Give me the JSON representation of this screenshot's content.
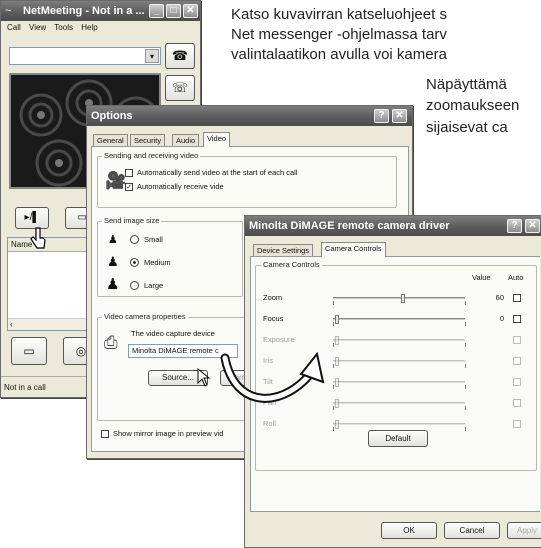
{
  "manual": {
    "line1": "Katso kuvavirran katseluohjeet s",
    "line2": "Net messenger -ohjelmassa tarv",
    "line3": "valintalaatikon avulla voi kamera",
    "line4": "Näpäyttämä",
    "line5": "zoomaukseen",
    "line6": "sijaisevat ca"
  },
  "netmeeting": {
    "title": "NetMeeting - Not in a ...",
    "menu": [
      "Call",
      "View",
      "Tools",
      "Help"
    ],
    "list_header": "Name",
    "status": "Not in a call"
  },
  "options": {
    "title": "Options",
    "tabs": [
      "General",
      "Security",
      "Audio",
      "Video"
    ],
    "group_sending": "Sending and receiving video",
    "auto_send": "Automatically send video at the start of each call",
    "auto_receive": "Automatically receive vide",
    "group_size": "Send image size",
    "size_small": "Small",
    "size_medium": "Medium",
    "size_large": "Large",
    "group_camera": "Video camera properties",
    "capture_device_text": "The video capture device",
    "device_select": "Minolta DiMAGE remote c",
    "source_button": "Source...",
    "format_button": "Forr",
    "mirror": "Show mirror image in preview vid"
  },
  "driver": {
    "title": "Minolta DiMAGE remote camera driver",
    "tab_device": "Device Settings",
    "tab_controls": "Camera Controls",
    "group": "Camera Controls",
    "col_value": "Value",
    "col_auto": "Auto",
    "rows": [
      {
        "label": "Zoom",
        "value": "60",
        "enabled": true
      },
      {
        "label": "Focus",
        "value": "0",
        "enabled": true
      },
      {
        "label": "Exposure",
        "value": "",
        "enabled": false
      },
      {
        "label": "Iris",
        "value": "",
        "enabled": false
      },
      {
        "label": "Tilt",
        "value": "",
        "enabled": false
      },
      {
        "label": "Pan",
        "value": "",
        "enabled": false
      },
      {
        "label": "Roll",
        "value": "",
        "enabled": false
      }
    ],
    "default_button": "Default",
    "ok_button": "OK",
    "cancel_button": "Cancel",
    "apply_button": "Apply"
  }
}
